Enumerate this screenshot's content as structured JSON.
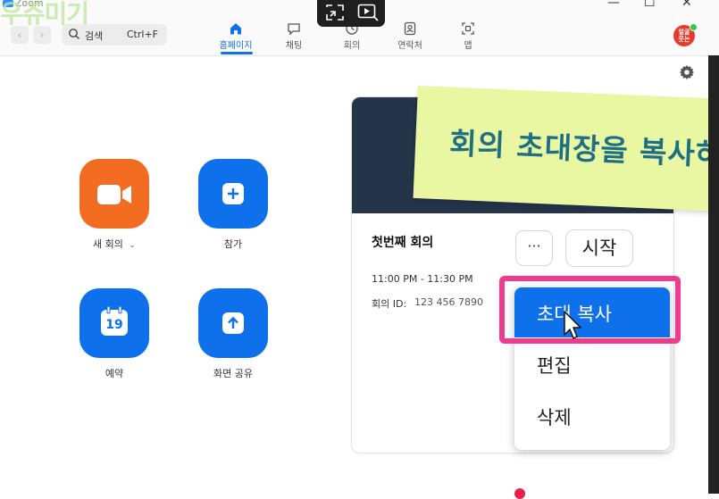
{
  "window": {
    "title": "Zoom",
    "watermark": "우쥬미기",
    "controls": [
      "—",
      "☐",
      "✕"
    ]
  },
  "nav": {
    "search_label": "검색",
    "search_shortcut": "Ctrl+F",
    "tabs": [
      {
        "label": "홈페이지",
        "icon": "home-icon",
        "active": true
      },
      {
        "label": "채팅",
        "icon": "chat-icon",
        "active": false
      },
      {
        "label": "회의",
        "icon": "clock-icon",
        "active": false
      },
      {
        "label": "연락처",
        "icon": "contacts-icon",
        "active": false
      },
      {
        "label": "앱",
        "icon": "apps-icon",
        "active": false
      }
    ],
    "avatar_text": "얼굴\n웃는"
  },
  "actions": [
    {
      "label": "새 회의",
      "has_dropdown": true,
      "icon": "video-camera-icon",
      "color": "#f26d21"
    },
    {
      "label": "참가",
      "icon": "plus-icon",
      "color": "#0e71eb"
    },
    {
      "label": "예약",
      "icon": "calendar-icon",
      "icon_text": "19",
      "color": "#0e71eb"
    },
    {
      "label": "화면 공유",
      "icon": "share-up-arrow-icon",
      "color": "#0e71eb"
    }
  ],
  "meeting": {
    "title": "첫번째 회의",
    "time": "11:00 PM - 11:30 PM",
    "id_label": "회의 ID:",
    "id": "123 456 7890",
    "more_label": "···",
    "start_label": "시작"
  },
  "menu": {
    "items": [
      {
        "label": "초대 복사",
        "highlighted": true
      },
      {
        "label": "편집",
        "highlighted": false
      },
      {
        "label": "삭제",
        "highlighted": false
      }
    ]
  },
  "caption": {
    "text": "회의 초대장을 복사하"
  },
  "colors": {
    "accent": "#0e71eb",
    "orange": "#f26d21",
    "highlight_border": "#ee3a8f",
    "caption_bg": "#e9f7a2",
    "caption_text": "#1e6f83"
  }
}
